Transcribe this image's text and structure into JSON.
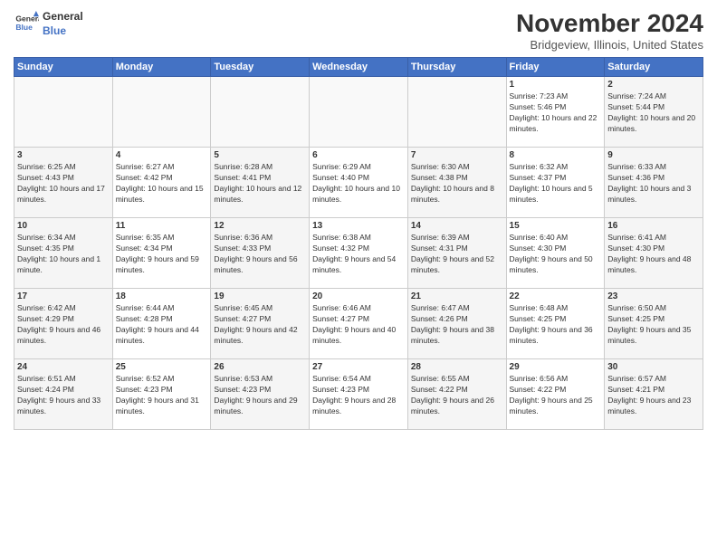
{
  "header": {
    "logo_line1": "General",
    "logo_line2": "Blue",
    "month": "November 2024",
    "location": "Bridgeview, Illinois, United States"
  },
  "weekdays": [
    "Sunday",
    "Monday",
    "Tuesday",
    "Wednesday",
    "Thursday",
    "Friday",
    "Saturday"
  ],
  "weeks": [
    [
      {
        "day": "",
        "info": ""
      },
      {
        "day": "",
        "info": ""
      },
      {
        "day": "",
        "info": ""
      },
      {
        "day": "",
        "info": ""
      },
      {
        "day": "",
        "info": ""
      },
      {
        "day": "1",
        "info": "Sunrise: 7:23 AM\nSunset: 5:46 PM\nDaylight: 10 hours and 22 minutes."
      },
      {
        "day": "2",
        "info": "Sunrise: 7:24 AM\nSunset: 5:44 PM\nDaylight: 10 hours and 20 minutes."
      }
    ],
    [
      {
        "day": "3",
        "info": "Sunrise: 6:25 AM\nSunset: 4:43 PM\nDaylight: 10 hours and 17 minutes."
      },
      {
        "day": "4",
        "info": "Sunrise: 6:27 AM\nSunset: 4:42 PM\nDaylight: 10 hours and 15 minutes."
      },
      {
        "day": "5",
        "info": "Sunrise: 6:28 AM\nSunset: 4:41 PM\nDaylight: 10 hours and 12 minutes."
      },
      {
        "day": "6",
        "info": "Sunrise: 6:29 AM\nSunset: 4:40 PM\nDaylight: 10 hours and 10 minutes."
      },
      {
        "day": "7",
        "info": "Sunrise: 6:30 AM\nSunset: 4:38 PM\nDaylight: 10 hours and 8 minutes."
      },
      {
        "day": "8",
        "info": "Sunrise: 6:32 AM\nSunset: 4:37 PM\nDaylight: 10 hours and 5 minutes."
      },
      {
        "day": "9",
        "info": "Sunrise: 6:33 AM\nSunset: 4:36 PM\nDaylight: 10 hours and 3 minutes."
      }
    ],
    [
      {
        "day": "10",
        "info": "Sunrise: 6:34 AM\nSunset: 4:35 PM\nDaylight: 10 hours and 1 minute."
      },
      {
        "day": "11",
        "info": "Sunrise: 6:35 AM\nSunset: 4:34 PM\nDaylight: 9 hours and 59 minutes."
      },
      {
        "day": "12",
        "info": "Sunrise: 6:36 AM\nSunset: 4:33 PM\nDaylight: 9 hours and 56 minutes."
      },
      {
        "day": "13",
        "info": "Sunrise: 6:38 AM\nSunset: 4:32 PM\nDaylight: 9 hours and 54 minutes."
      },
      {
        "day": "14",
        "info": "Sunrise: 6:39 AM\nSunset: 4:31 PM\nDaylight: 9 hours and 52 minutes."
      },
      {
        "day": "15",
        "info": "Sunrise: 6:40 AM\nSunset: 4:30 PM\nDaylight: 9 hours and 50 minutes."
      },
      {
        "day": "16",
        "info": "Sunrise: 6:41 AM\nSunset: 4:30 PM\nDaylight: 9 hours and 48 minutes."
      }
    ],
    [
      {
        "day": "17",
        "info": "Sunrise: 6:42 AM\nSunset: 4:29 PM\nDaylight: 9 hours and 46 minutes."
      },
      {
        "day": "18",
        "info": "Sunrise: 6:44 AM\nSunset: 4:28 PM\nDaylight: 9 hours and 44 minutes."
      },
      {
        "day": "19",
        "info": "Sunrise: 6:45 AM\nSunset: 4:27 PM\nDaylight: 9 hours and 42 minutes."
      },
      {
        "day": "20",
        "info": "Sunrise: 6:46 AM\nSunset: 4:27 PM\nDaylight: 9 hours and 40 minutes."
      },
      {
        "day": "21",
        "info": "Sunrise: 6:47 AM\nSunset: 4:26 PM\nDaylight: 9 hours and 38 minutes."
      },
      {
        "day": "22",
        "info": "Sunrise: 6:48 AM\nSunset: 4:25 PM\nDaylight: 9 hours and 36 minutes."
      },
      {
        "day": "23",
        "info": "Sunrise: 6:50 AM\nSunset: 4:25 PM\nDaylight: 9 hours and 35 minutes."
      }
    ],
    [
      {
        "day": "24",
        "info": "Sunrise: 6:51 AM\nSunset: 4:24 PM\nDaylight: 9 hours and 33 minutes."
      },
      {
        "day": "25",
        "info": "Sunrise: 6:52 AM\nSunset: 4:23 PM\nDaylight: 9 hours and 31 minutes."
      },
      {
        "day": "26",
        "info": "Sunrise: 6:53 AM\nSunset: 4:23 PM\nDaylight: 9 hours and 29 minutes."
      },
      {
        "day": "27",
        "info": "Sunrise: 6:54 AM\nSunset: 4:23 PM\nDaylight: 9 hours and 28 minutes."
      },
      {
        "day": "28",
        "info": "Sunrise: 6:55 AM\nSunset: 4:22 PM\nDaylight: 9 hours and 26 minutes."
      },
      {
        "day": "29",
        "info": "Sunrise: 6:56 AM\nSunset: 4:22 PM\nDaylight: 9 hours and 25 minutes."
      },
      {
        "day": "30",
        "info": "Sunrise: 6:57 AM\nSunset: 4:21 PM\nDaylight: 9 hours and 23 minutes."
      }
    ]
  ]
}
